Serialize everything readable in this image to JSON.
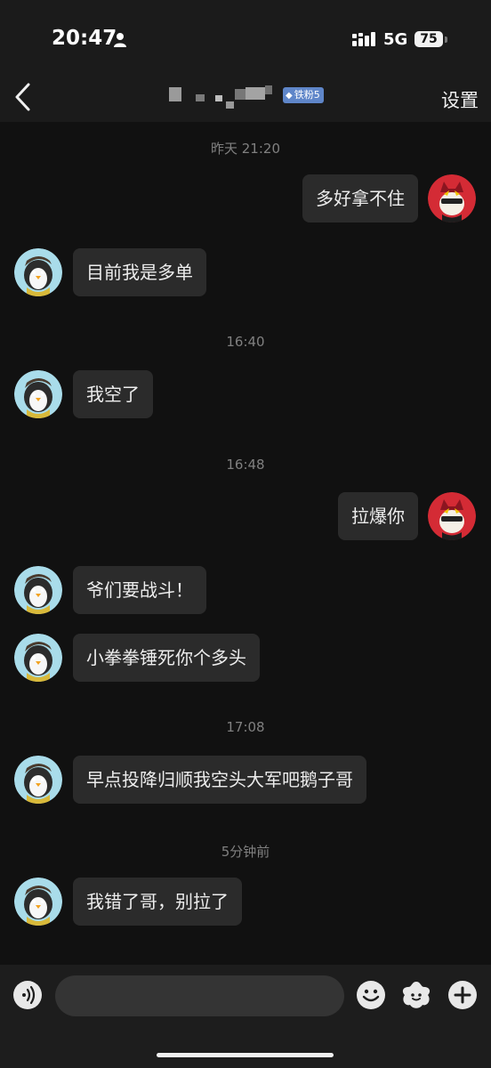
{
  "status_bar": {
    "time": "20:47",
    "network": "5G",
    "battery": "75"
  },
  "header": {
    "badge": "铁粉5",
    "settings": "设置"
  },
  "messages": [
    {
      "type": "timestamp",
      "text": "昨天 21:20"
    },
    {
      "type": "msg",
      "side": "right",
      "text": "多好拿不住"
    },
    {
      "type": "msg",
      "side": "left",
      "text": "目前我是多单"
    },
    {
      "type": "timestamp",
      "text": "16:40"
    },
    {
      "type": "msg",
      "side": "left",
      "text": "我空了"
    },
    {
      "type": "timestamp",
      "text": "16:48"
    },
    {
      "type": "msg",
      "side": "right",
      "text": "拉爆你"
    },
    {
      "type": "msg",
      "side": "left",
      "text": "爷们要战斗！"
    },
    {
      "type": "msg",
      "side": "left",
      "text": "小拳拳锤死你个多头"
    },
    {
      "type": "timestamp",
      "text": "17:08"
    },
    {
      "type": "msg",
      "side": "left",
      "text": "早点投降归顺我空头大军吧鹅子哥"
    },
    {
      "type": "timestamp",
      "text": "5分钟前"
    },
    {
      "type": "msg",
      "side": "left",
      "text": "我错了哥，别拉了"
    }
  ],
  "input": {
    "placeholder": ""
  },
  "icons": {
    "back": "chevron-left-icon",
    "voice": "voice-icon",
    "emoji": "emoji-icon",
    "sticker": "sticker-icon",
    "plus": "plus-icon",
    "avatar_left": "penguin-avatar",
    "avatar_right": "red-cat-avatar"
  }
}
